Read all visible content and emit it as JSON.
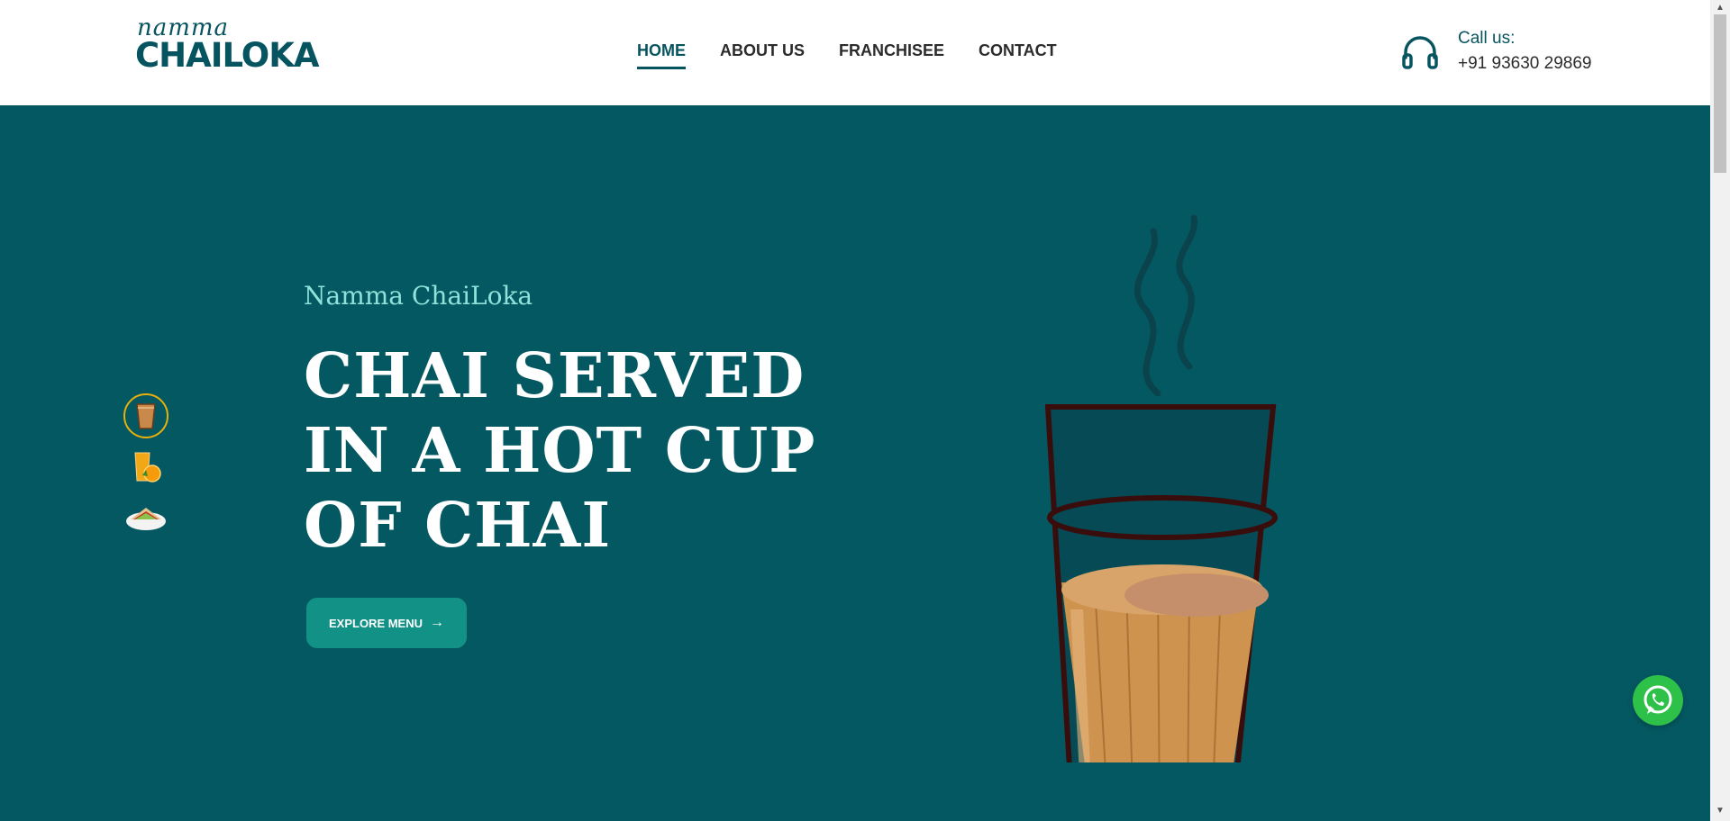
{
  "brand": {
    "script": "namma",
    "name": "CHAILOKA",
    "primary_color": "#06545f",
    "hero_background": "#045862",
    "button_color": "#129286"
  },
  "nav": {
    "items": [
      {
        "label": "HOME",
        "active": true
      },
      {
        "label": "ABOUT US",
        "active": false
      },
      {
        "label": "FRANCHISEE",
        "active": false
      },
      {
        "label": "CONTACT",
        "active": false
      }
    ]
  },
  "contact": {
    "label": "Call us:",
    "phone": "+91 93630 29869",
    "icon": "headset-icon"
  },
  "hero": {
    "subtitle": "Namma ChaiLoka",
    "title_lines": [
      "CHAI SERVED",
      "IN A HOT CUP",
      "OF CHAI"
    ],
    "button_label": "EXPLORE MENU",
    "button_icon": "arrow-right-icon"
  },
  "thumbnails": [
    {
      "name": "chai-glass",
      "active": true
    },
    {
      "name": "orange-juice",
      "active": false
    },
    {
      "name": "sandwich",
      "active": false
    }
  ],
  "floating": {
    "icon": "whatsapp-icon"
  }
}
